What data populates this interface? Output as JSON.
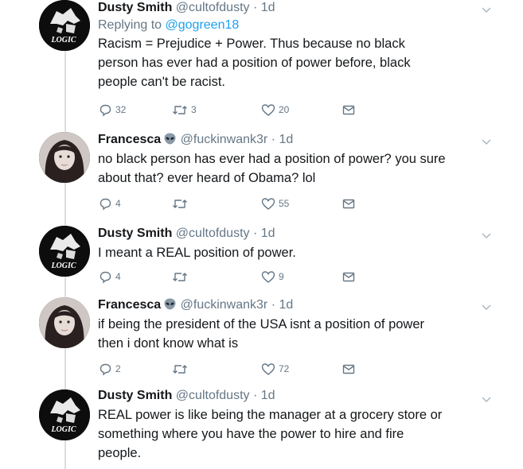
{
  "tweets": [
    {
      "name": "Dusty Smith",
      "handle": "@cultofdusty",
      "time": "1d",
      "replying_prefix": "Replying to ",
      "replying_handle": "@gogreen18",
      "text": "Racism = Prejudice + Power. Thus because no black\nperson has ever had a position of power before, black\npeople can't be racist.",
      "replies": "32",
      "retweets": "3",
      "likes": "20",
      "avatar_text": "LOGIC"
    },
    {
      "name": "Francesca",
      "handle": "@fuckinwank3r",
      "time": "1d",
      "text": "no black person has ever had a position of power? you sure\nabout that? ever heard of Obama? lol",
      "replies": "4",
      "retweets": "",
      "likes": "55"
    },
    {
      "name": "Dusty Smith",
      "handle": "@cultofdusty",
      "time": "1d",
      "text": "I meant a REAL position of power.",
      "replies": "4",
      "retweets": "",
      "likes": "9",
      "avatar_text": "LOGIC"
    },
    {
      "name": "Francesca",
      "handle": "@fuckinwank3r",
      "time": "1d",
      "text": "if being the president of the USA isnt a position of power\nthen i dont know what is",
      "replies": "2",
      "retweets": "",
      "likes": "72"
    },
    {
      "name": "Dusty Smith",
      "handle": "@cultofdusty",
      "time": "1d",
      "text": "REAL power is like being the manager at a grocery store or\nsomething where you have the power to hire and fire\npeople.",
      "avatar_text": "LOGIC"
    }
  ],
  "icons": {
    "reply": "reply-icon",
    "retweet": "retweet-icon",
    "like": "heart-icon",
    "dm": "envelope-icon",
    "more": "chevron-down-icon",
    "badge": "alien-emoji-icon"
  },
  "colors": {
    "link": "#1da1f2",
    "secondary_text": "#657786",
    "thread_line": "#d9dee3"
  }
}
